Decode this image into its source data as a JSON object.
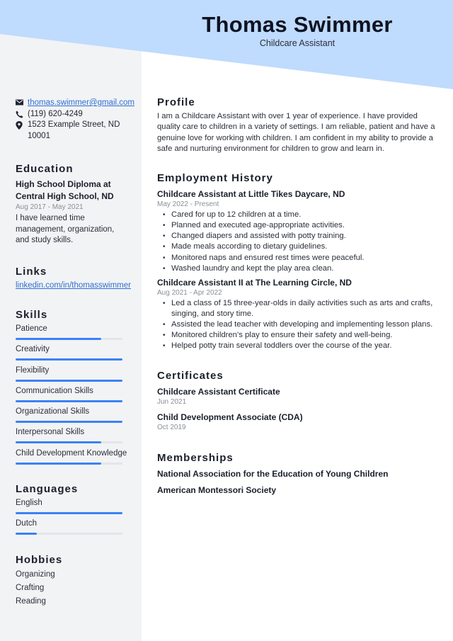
{
  "header": {
    "name": "Thomas Swimmer",
    "title": "Childcare Assistant"
  },
  "colors": {
    "accent": "#3b82f6",
    "header_band": "#bfdbfe",
    "sidebar_bg": "#f2f3f5",
    "link": "#2f6fd1"
  },
  "contact": {
    "email": "thomas.swimmer@gmail.com",
    "phone": "(119) 620-4249",
    "address_line1": "1523 Example Street, ND",
    "address_line2": "10001",
    "icons": [
      "envelope-icon",
      "phone-icon",
      "map-pin-icon"
    ]
  },
  "education": {
    "heading": "Education",
    "degree_line1": "High School Diploma at",
    "degree_line2": "Central High School, ND",
    "dates": "Aug 2017 - May 2021",
    "description": "I have learned time management, organization, and study skills."
  },
  "links": {
    "heading": "Links",
    "items": [
      {
        "label": "linkedin.com/in/thomasswimmer"
      }
    ]
  },
  "skills": {
    "heading": "Skills",
    "items": [
      {
        "label": "Patience",
        "level": 0.8
      },
      {
        "label": "Creativity",
        "level": 1.0
      },
      {
        "label": "Flexibility",
        "level": 1.0
      },
      {
        "label": "Communication Skills",
        "level": 1.0
      },
      {
        "label": "Organizational Skills",
        "level": 1.0
      },
      {
        "label": "Interpersonal Skills",
        "level": 0.8
      },
      {
        "label": "Child Development Knowledge",
        "level": 0.8
      }
    ]
  },
  "languages": {
    "heading": "Languages",
    "items": [
      {
        "label": "English",
        "level": 1.0
      },
      {
        "label": "Dutch",
        "level": 0.2
      }
    ]
  },
  "hobbies": {
    "heading": "Hobbies",
    "items": [
      "Organizing",
      "Crafting",
      "Reading"
    ]
  },
  "profile": {
    "heading": "Profile",
    "text": "I am a Childcare Assistant with over 1 year of experience. I have provided quality care to children in a variety of settings. I am reliable, patient and have a genuine love for working with children. I am confident in my ability to provide a safe and nurturing environment for children to grow and learn in."
  },
  "employment": {
    "heading": "Employment History",
    "jobs": [
      {
        "title": "Childcare Assistant at Little Tikes Daycare, ND",
        "dates": "May 2022 - Present",
        "bullets": [
          "Cared for up to 12 children at a time.",
          "Planned and executed age-appropriate activities.",
          "Changed diapers and assisted with potty training.",
          "Made meals according to dietary guidelines.",
          "Monitored naps and ensured rest times were peaceful.",
          "Washed laundry and kept the play area clean."
        ]
      },
      {
        "title": "Childcare Assistant II at The Learning Circle, ND",
        "dates": "Aug 2021 - Apr 2022",
        "bullets": [
          "Led a class of 15 three-year-olds in daily activities such as arts and crafts, singing, and story time.",
          "Assisted the lead teacher with developing and implementing lesson plans.",
          "Monitored children’s play to ensure their safety and well-being.",
          "Helped potty train several toddlers over the course of the year."
        ]
      }
    ]
  },
  "certificates": {
    "heading": "Certificates",
    "items": [
      {
        "name": "Childcare Assistant Certificate",
        "date": "Jun 2021"
      },
      {
        "name": "Child Development Associate (CDA)",
        "date": "Oct 2019"
      }
    ]
  },
  "memberships": {
    "heading": "Memberships",
    "items": [
      "National Association for the Education of Young Children",
      "American Montessori Society"
    ]
  }
}
